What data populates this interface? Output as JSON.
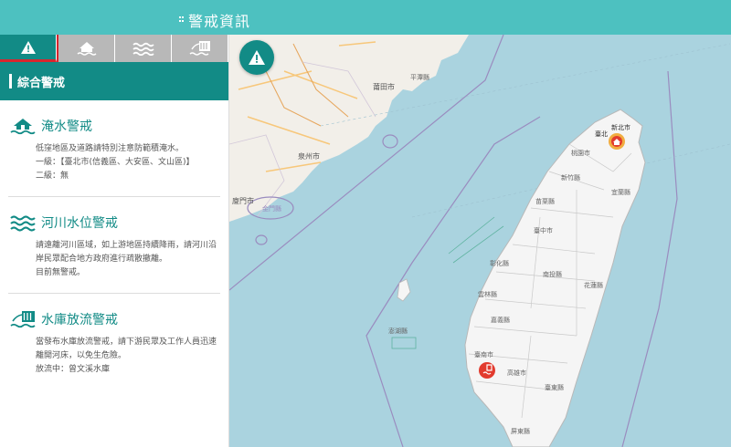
{
  "header": {
    "title": "警戒資訊"
  },
  "tabs": [
    {
      "icon": "warning-icon"
    },
    {
      "icon": "flood-house-icon"
    },
    {
      "icon": "water-waves-icon"
    },
    {
      "icon": "dam-release-icon"
    }
  ],
  "section": {
    "title": "綜合警戒"
  },
  "cards": [
    {
      "title": "淹水警戒",
      "lines": [
        "低窪地區及道路請特別注意防範積淹水。",
        "一級：【臺北市(信義區、大安區、文山區)】",
        "二級：無"
      ]
    },
    {
      "title": "河川水位警戒",
      "lines": [
        "請遠離河川區域，如上游地區持續降雨，請河川沿",
        "岸民眾配合地方政府進行疏散撤離。",
        "目前無警戒。"
      ]
    },
    {
      "title": "水庫放流警戒",
      "lines": [
        "當發布水庫放流警戒，請下游民眾及工作人員迅速",
        "離開河床，以免生危險。",
        "放流中：曾文溪水庫"
      ]
    }
  ],
  "map": {
    "labels": {
      "putian": "莆田市",
      "quanzhou": "泉州市",
      "xiamen": "廈門市",
      "jinmen": "金門縣",
      "yilan": "宜蘭縣",
      "hsinchu": "新竹縣",
      "taoyuan": "桃園市",
      "miaoli": "苗栗縣",
      "taichung": "臺中市",
      "changhua": "彰化縣",
      "nantou": "南投縣",
      "yunlin": "雲林縣",
      "chiayi": "嘉義縣",
      "hualien": "花蓮縣",
      "penghu": "澎湖縣",
      "tainan": "臺南市",
      "kaohsiung": "高雄市",
      "taitung": "臺東縣",
      "pingtung": "屏東縣",
      "taipei": "臺北",
      "newtaipei": "新北市",
      "pingtan": "平潭縣"
    }
  }
}
